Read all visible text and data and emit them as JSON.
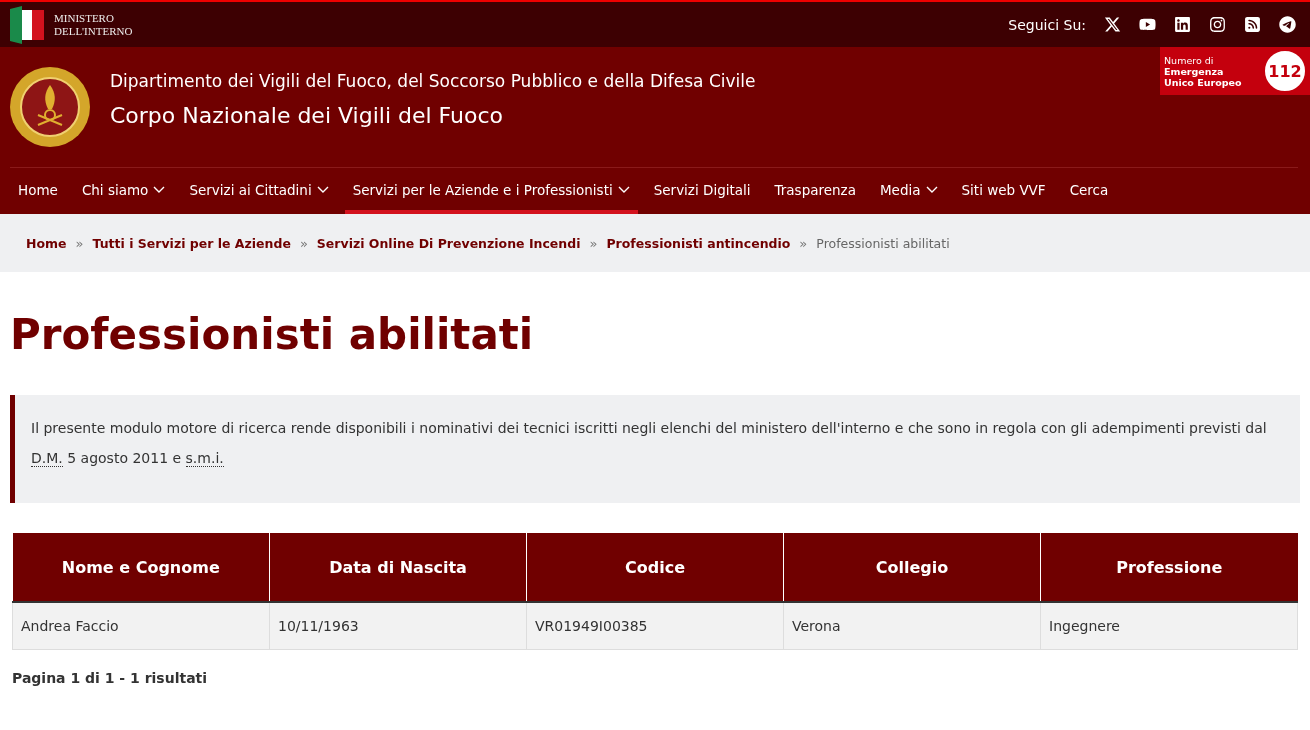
{
  "top_bar": {
    "ministry": [
      "MINISTERO",
      "DELL'INTERNO"
    ],
    "follow_label": "Seguici Su:"
  },
  "header": {
    "department": "Dipartimento dei Vigili del Fuoco, del Soccorso Pubblico e della Difesa Civile",
    "corps": "Corpo Nazionale dei Vigili del Fuoco",
    "emergency": {
      "lines": [
        "Numero di",
        "Emergenza",
        "Unico Europeo"
      ],
      "number": "112"
    }
  },
  "nav": [
    {
      "label": "Home",
      "dropdown": false,
      "selected": false
    },
    {
      "label": "Chi siamo",
      "dropdown": true,
      "selected": false
    },
    {
      "label": "Servizi ai Cittadini",
      "dropdown": true,
      "selected": false
    },
    {
      "label": "Servizi per le Aziende e i Professionisti",
      "dropdown": true,
      "selected": true
    },
    {
      "label": "Servizi Digitali",
      "dropdown": false,
      "selected": false
    },
    {
      "label": "Trasparenza",
      "dropdown": false,
      "selected": false
    },
    {
      "label": "Media",
      "dropdown": true,
      "selected": false
    },
    {
      "label": "Siti web VVF",
      "dropdown": false,
      "selected": false
    },
    {
      "label": "Cerca",
      "dropdown": false,
      "selected": false
    }
  ],
  "breadcrumb": {
    "separator": "»",
    "items": [
      "Home",
      "Tutti i Servizi per le Aziende",
      "Servizi Online Di Prevenzione Incendi",
      "Professionisti antincendio"
    ],
    "current": "Professionisti abilitati"
  },
  "title": "Professionisti abilitati",
  "intro": [
    {
      "kind": "text",
      "text": "Il presente modulo motore di ricerca rende disponibili i nominativi dei tecnici iscritti negli elenchi del ministero dell'interno e che sono in regola con gli adempimenti previsti dal "
    },
    {
      "kind": "abbr",
      "text": "D.M."
    },
    {
      "kind": "text",
      "text": " 5 agosto 2011 e "
    },
    {
      "kind": "abbr",
      "text": "s.m.i."
    }
  ],
  "table": {
    "columns": [
      "Nome e Cognome",
      "Data di Nascita",
      "Codice",
      "Collegio",
      "Professione"
    ],
    "rows": [
      [
        "Andrea Faccio",
        "10/11/1963",
        "VR01949I00385",
        "Verona",
        "Ingegnere"
      ]
    ]
  },
  "pagination": "Pagina 1 di 1 - 1 risultati"
}
